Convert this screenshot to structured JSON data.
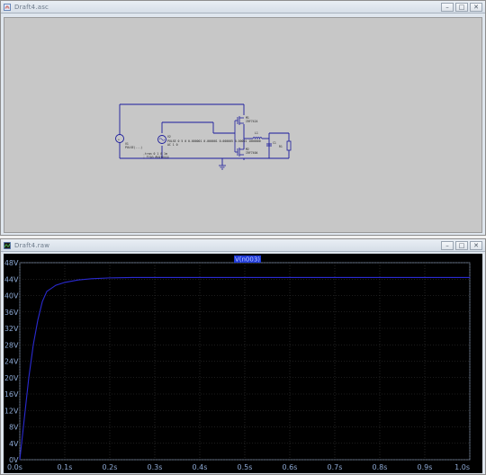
{
  "schematic_window": {
    "title": "Draft4.asc",
    "controls": {
      "minimize": "–",
      "restore": "□",
      "close": "✕"
    },
    "components": {
      "v1_label": "V1",
      "v1_value": "PULSE(...)",
      "v2_label": "V2",
      "v2_value": "PULSE 0 5 0 0.000001 0.000001 0.000005 0.00001 1000000",
      "v2_extra": "AC 1 0",
      "m1_label": "M1",
      "m1_model": "IRF7424",
      "m2_label": "M2",
      "m2_model": "IRF7404",
      "l1_label": "L1",
      "c1_label": "C1",
      "r1_label": "R1",
      "sim_cmd_1": ".tran 0 1 0 1m",
      "sim_cmd_2": "; Tran Analysis"
    }
  },
  "waveform_window": {
    "title": "Draft4.raw",
    "controls": {
      "minimize": "–",
      "restore": "□",
      "close": "✕"
    },
    "trace_label": "V(n003)"
  },
  "chart_data": {
    "type": "line",
    "xlabel": "",
    "ylabel": "",
    "x_ticks": [
      "0.0s",
      "0.1s",
      "0.2s",
      "0.3s",
      "0.4s",
      "0.5s",
      "0.6s",
      "0.7s",
      "0.8s",
      "0.9s",
      "1.0s"
    ],
    "y_ticks": [
      "0V",
      "4V",
      "8V",
      "12V",
      "16V",
      "20V",
      "24V",
      "28V",
      "32V",
      "36V",
      "40V",
      "44V",
      "48V"
    ],
    "xlim": [
      0,
      1.0
    ],
    "ylim": [
      0,
      48
    ],
    "grid": true,
    "series": [
      {
        "name": "V(n003)",
        "color": "#2a2ad0",
        "x": [
          0,
          0.01,
          0.02,
          0.03,
          0.04,
          0.05,
          0.06,
          0.08,
          0.1,
          0.13,
          0.16,
          0.2,
          0.25,
          0.3,
          0.4,
          0.5,
          0.6,
          0.7,
          0.8,
          0.9,
          1.0
        ],
        "y": [
          0,
          10,
          20,
          28,
          34,
          38.5,
          41,
          42.5,
          43.2,
          43.8,
          44.1,
          44.3,
          44.4,
          44.4,
          44.4,
          44.4,
          44.4,
          44.4,
          44.4,
          44.4,
          44.4
        ]
      }
    ]
  }
}
